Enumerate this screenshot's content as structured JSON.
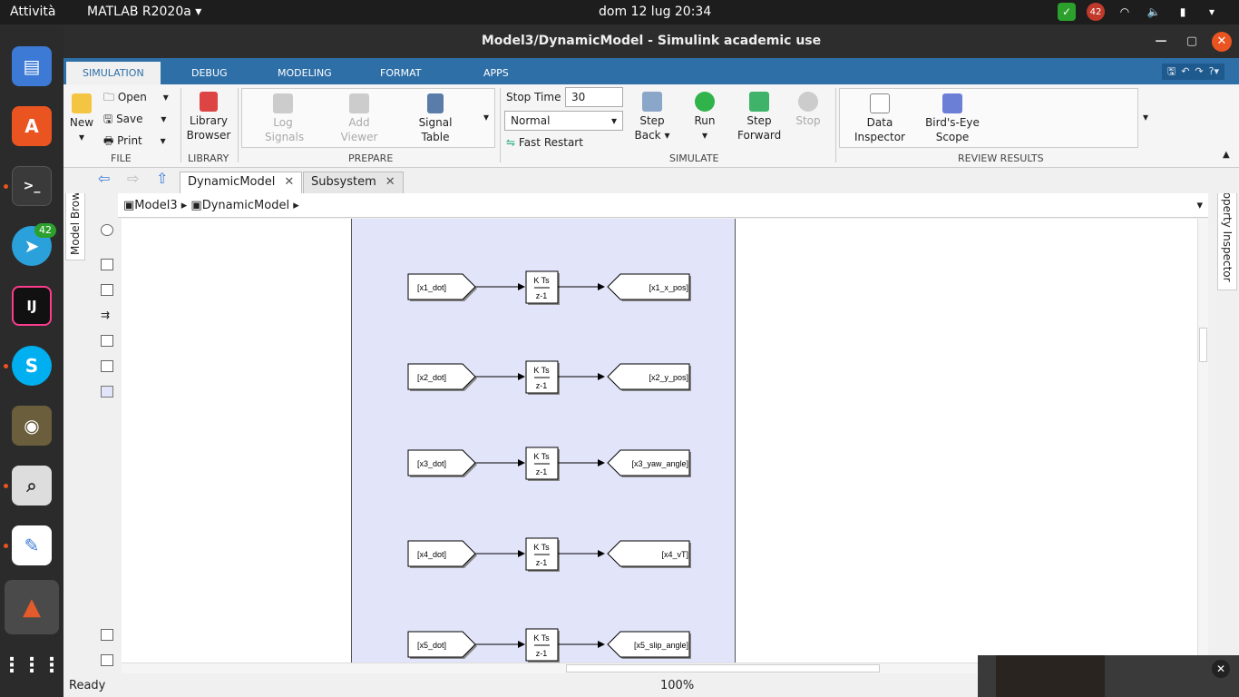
{
  "system": {
    "activities": "Attività",
    "app_menu": "MATLAB R2020a",
    "clock": "dom 12 lug  20:34",
    "notification_badge": "42"
  },
  "dock": {
    "telegram_badge": "42"
  },
  "window": {
    "title": "Model3/DynamicModel - Simulink academic use"
  },
  "ribbon_tabs": [
    "SIMULATION",
    "DEBUG",
    "MODELING",
    "FORMAT",
    "APPS"
  ],
  "ribbon": {
    "file": {
      "new": "New",
      "open": "Open",
      "save": "Save",
      "print": "Print",
      "label": "FILE"
    },
    "library": {
      "browser_1": "Library",
      "browser_2": "Browser",
      "label": "LIBRARY"
    },
    "prepare": {
      "log_1": "Log",
      "log_2": "Signals",
      "add_1": "Add",
      "add_2": "Viewer",
      "sig_1": "Signal",
      "sig_2": "Table",
      "label": "PREPARE"
    },
    "simulate": {
      "stop_time_label": "Stop Time",
      "stop_time_value": "30",
      "mode": "Normal",
      "fast_restart": "Fast Restart",
      "step_back_1": "Step",
      "step_back_2": "Back",
      "run": "Run",
      "step_fwd_1": "Step",
      "step_fwd_2": "Forward",
      "stop": "Stop",
      "label": "SIMULATE"
    },
    "review": {
      "data_1": "Data",
      "data_2": "Inspector",
      "bird_1": "Bird's-Eye",
      "bird_2": "Scope",
      "label": "REVIEW RESULTS"
    }
  },
  "editor_tabs": [
    {
      "label": "DynamicModel"
    },
    {
      "label": "Subsystem"
    }
  ],
  "side": {
    "model_browser": "Model Browser",
    "property_inspector": "Property Inspector"
  },
  "breadcrumb": [
    "Model3",
    "DynamicModel"
  ],
  "diagram": {
    "rows": [
      {
        "from": "[x1_dot]",
        "gain_top": "K Ts",
        "gain_bottom": "z-1",
        "goto": "[x1_x_pos]"
      },
      {
        "from": "[x2_dot]",
        "gain_top": "K Ts",
        "gain_bottom": "z-1",
        "goto": "[x2_y_pos]"
      },
      {
        "from": "[x3_dot]",
        "gain_top": "K Ts",
        "gain_bottom": "z-1",
        "goto": "[x3_yaw_angle]"
      },
      {
        "from": "[x4_dot]",
        "gain_top": "K Ts",
        "gain_bottom": "z-1",
        "goto": "[x4_vT]"
      },
      {
        "from": "[x5_dot]",
        "gain_top": "K Ts",
        "gain_bottom": "z-1",
        "goto": "[x5_slip_angle]"
      }
    ]
  },
  "status": {
    "state": "Ready",
    "zoom": "100%"
  }
}
